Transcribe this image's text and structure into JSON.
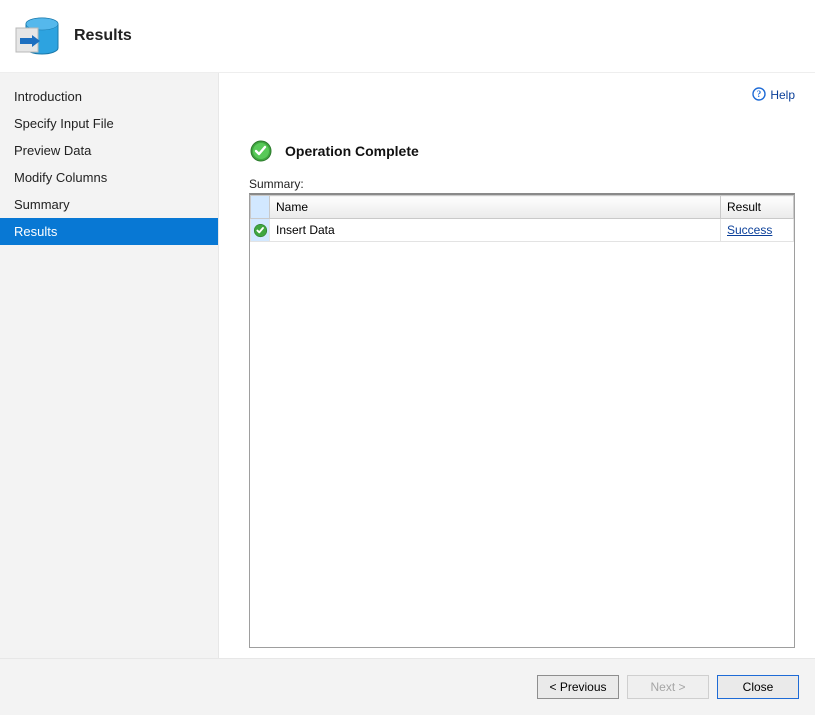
{
  "header": {
    "title": "Results"
  },
  "help": {
    "label": "Help"
  },
  "sidebar": {
    "items": [
      {
        "label": "Introduction"
      },
      {
        "label": "Specify Input File"
      },
      {
        "label": "Preview Data"
      },
      {
        "label": "Modify Columns"
      },
      {
        "label": "Summary"
      },
      {
        "label": "Results"
      }
    ],
    "selected_index": 5
  },
  "operation": {
    "title": "Operation Complete"
  },
  "summary": {
    "label": "Summary:",
    "columns": {
      "name": "Name",
      "result": "Result"
    },
    "rows": [
      {
        "name": "Insert Data",
        "result": "Success"
      }
    ]
  },
  "footer": {
    "previous": "< Previous",
    "next": "Next >",
    "close": "Close"
  }
}
